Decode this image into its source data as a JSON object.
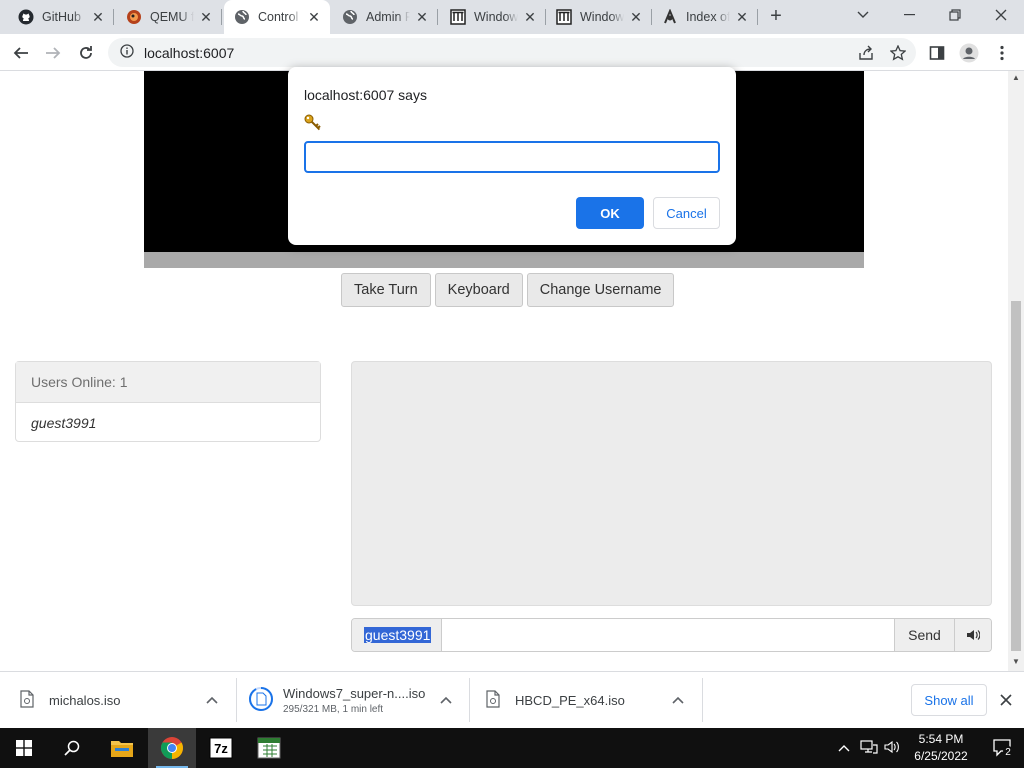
{
  "browser": {
    "tabs": [
      {
        "label": "GitHub",
        "icon": "github-icon"
      },
      {
        "label": "QEMU f",
        "icon": "qemu-icon"
      },
      {
        "label": "Control",
        "icon": "globe-icon",
        "active": true
      },
      {
        "label": "Admin P",
        "icon": "globe-icon"
      },
      {
        "label": "Window",
        "icon": "archive-icon"
      },
      {
        "label": "Window",
        "icon": "archive-icon"
      },
      {
        "label": "Index of",
        "icon": "index-icon"
      }
    ],
    "url": "localhost:6007"
  },
  "dialog": {
    "title": "localhost:6007 says",
    "input_value": "",
    "ok_label": "OK",
    "cancel_label": "Cancel"
  },
  "controls": {
    "take_turn": "Take Turn",
    "keyboard": "Keyboard",
    "change_username": "Change Username"
  },
  "users_panel": {
    "header": "Users Online: 1",
    "users": [
      "guest3991"
    ]
  },
  "chat": {
    "username": "guest3991",
    "message_value": "",
    "send_label": "Send"
  },
  "downloads": [
    {
      "name": "michalos.iso",
      "status": ""
    },
    {
      "name": "Windows7_super-n....iso",
      "status": "295/321 MB, 1 min left",
      "progress": 0.92
    },
    {
      "name": "HBCD_PE_x64.iso",
      "status": ""
    }
  ],
  "downloads_bar": {
    "show_all": "Show all"
  },
  "taskbar": {
    "time": "5:54 PM",
    "date": "6/25/2022",
    "notification_count": "2",
    "sevenzip_label": "7z"
  },
  "colors": {
    "accent": "#1a73e8",
    "taskbar": "#101010",
    "chat_selection": "#3367d6"
  }
}
